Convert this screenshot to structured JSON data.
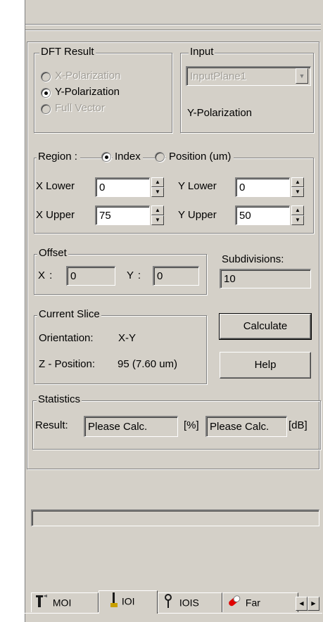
{
  "dft_result": {
    "title": "DFT Result",
    "options": [
      {
        "label": "X-Polarization",
        "selected": false,
        "enabled": false
      },
      {
        "label": "Y-Polarization",
        "selected": true,
        "enabled": true
      },
      {
        "label": "Full Vector",
        "selected": false,
        "enabled": false
      }
    ]
  },
  "input": {
    "title": "Input",
    "plane_value": "InputPlane1",
    "polarization": "Y-Polarization"
  },
  "region": {
    "title": "Region :",
    "index_label": "Index",
    "position_label": "Position (um)",
    "selected": "Index",
    "x_lower_label": "X Lower",
    "x_lower": "0",
    "y_lower_label": "Y Lower",
    "y_lower": "0",
    "x_upper_label": "X Upper",
    "x_upper": "75",
    "y_upper_label": "Y Upper",
    "y_upper": "50"
  },
  "offset": {
    "title": "Offset",
    "x_label": "X :",
    "x_value": "0",
    "y_label": "Y :",
    "y_value": "0"
  },
  "subdivisions": {
    "label": "Subdivisions:",
    "value": "10"
  },
  "current_slice": {
    "title": "Current Slice",
    "orientation_label": "Orientation:",
    "orientation_value": "X-Y",
    "zpos_label": "Z - Position:",
    "zpos_value": "95 (7.60 um)"
  },
  "buttons": {
    "calculate": "Calculate",
    "help": "Help"
  },
  "statistics": {
    "title": "Statistics",
    "result_label": "Result:",
    "value1": "Please Calc.",
    "unit1": "[%]",
    "value2": "Please Calc.",
    "unit2": "[dB]"
  },
  "progress": {
    "value": 0
  },
  "tabs": [
    {
      "label": "MOI",
      "icon": "wrench-icon",
      "active": false
    },
    {
      "label": "IOI",
      "icon": "probe-icon",
      "active": true
    },
    {
      "label": "IOIS",
      "icon": "pin-icon",
      "active": false
    },
    {
      "label": "Far",
      "icon": "pill-icon",
      "active": false
    }
  ],
  "colors": {
    "face": "#d4d0c8",
    "shadow": "#808080",
    "disabled_text": "#a19e97"
  }
}
